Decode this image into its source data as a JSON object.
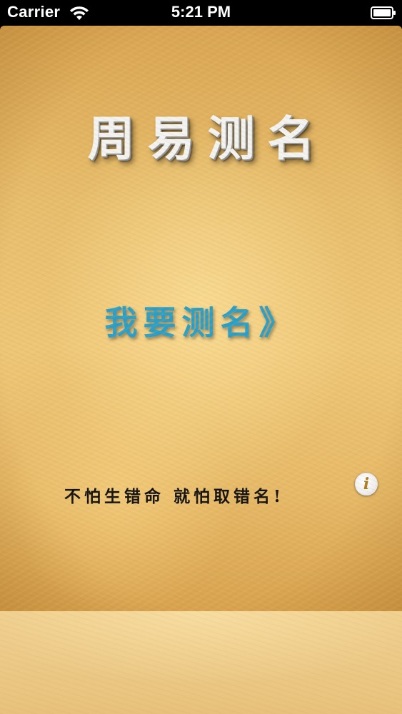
{
  "status_bar": {
    "carrier": "Carrier",
    "time": "5:21 PM",
    "icons": [
      "wifi-icon",
      "battery-icon"
    ]
  },
  "main": {
    "title": "周易测名",
    "start_button_label": "我要测名》",
    "slogan": "不怕生错命 就怕取错名!",
    "info_button_glyph": "i"
  },
  "colors": {
    "title": "#f3f3f1",
    "start_link": "#2a9fc7",
    "slogan": "#111111",
    "parchment": "#e7bd6c"
  }
}
